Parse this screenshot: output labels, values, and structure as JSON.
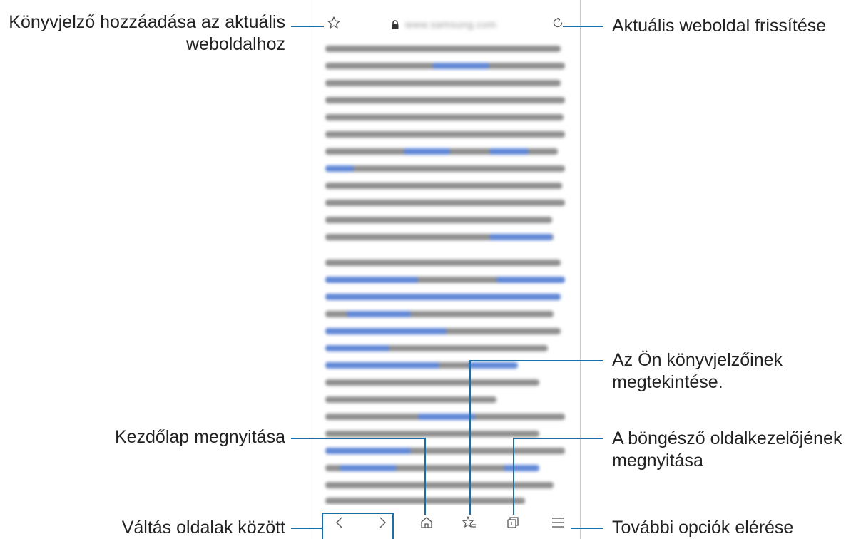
{
  "browser": {
    "url_text": "www.samsung.com",
    "accent_color": "#1b6fa8"
  },
  "toolbar_icons": [
    "star-icon",
    "lock-icon",
    "refresh-icon",
    "back-icon",
    "forward-icon",
    "home-icon",
    "bookmarks-icon",
    "tabs-icon",
    "menu-icon"
  ],
  "callouts": {
    "bookmark_line1": "Könyvjelző hozzáadása az aktuális",
    "bookmark_line2": "weboldalhoz",
    "refresh": "Aktuális weboldal frissítése",
    "bookmarks_view_line1": "Az Ön könyvjelzőinek",
    "bookmarks_view_line2": "megtekintése.",
    "home": "Kezdőlap megnyitása",
    "tabs_line1": "A böngésző oldalkezelőjének",
    "tabs_line2": "megnyitása",
    "navigate": "Váltás oldalak között",
    "more": "További opciók elérése"
  }
}
